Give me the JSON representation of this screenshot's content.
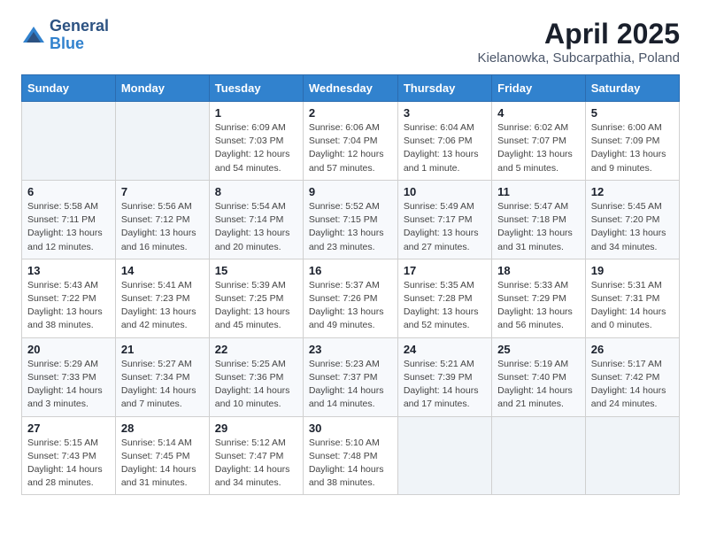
{
  "logo": {
    "general": "General",
    "blue": "Blue"
  },
  "header": {
    "title": "April 2025",
    "subtitle": "Kielanowka, Subcarpathia, Poland"
  },
  "weekdays": [
    "Sunday",
    "Monday",
    "Tuesday",
    "Wednesday",
    "Thursday",
    "Friday",
    "Saturday"
  ],
  "weeks": [
    [
      {
        "day": "",
        "info": ""
      },
      {
        "day": "",
        "info": ""
      },
      {
        "day": "1",
        "info": "Sunrise: 6:09 AM\nSunset: 7:03 PM\nDaylight: 12 hours and 54 minutes."
      },
      {
        "day": "2",
        "info": "Sunrise: 6:06 AM\nSunset: 7:04 PM\nDaylight: 12 hours and 57 minutes."
      },
      {
        "day": "3",
        "info": "Sunrise: 6:04 AM\nSunset: 7:06 PM\nDaylight: 13 hours and 1 minute."
      },
      {
        "day": "4",
        "info": "Sunrise: 6:02 AM\nSunset: 7:07 PM\nDaylight: 13 hours and 5 minutes."
      },
      {
        "day": "5",
        "info": "Sunrise: 6:00 AM\nSunset: 7:09 PM\nDaylight: 13 hours and 9 minutes."
      }
    ],
    [
      {
        "day": "6",
        "info": "Sunrise: 5:58 AM\nSunset: 7:11 PM\nDaylight: 13 hours and 12 minutes."
      },
      {
        "day": "7",
        "info": "Sunrise: 5:56 AM\nSunset: 7:12 PM\nDaylight: 13 hours and 16 minutes."
      },
      {
        "day": "8",
        "info": "Sunrise: 5:54 AM\nSunset: 7:14 PM\nDaylight: 13 hours and 20 minutes."
      },
      {
        "day": "9",
        "info": "Sunrise: 5:52 AM\nSunset: 7:15 PM\nDaylight: 13 hours and 23 minutes."
      },
      {
        "day": "10",
        "info": "Sunrise: 5:49 AM\nSunset: 7:17 PM\nDaylight: 13 hours and 27 minutes."
      },
      {
        "day": "11",
        "info": "Sunrise: 5:47 AM\nSunset: 7:18 PM\nDaylight: 13 hours and 31 minutes."
      },
      {
        "day": "12",
        "info": "Sunrise: 5:45 AM\nSunset: 7:20 PM\nDaylight: 13 hours and 34 minutes."
      }
    ],
    [
      {
        "day": "13",
        "info": "Sunrise: 5:43 AM\nSunset: 7:22 PM\nDaylight: 13 hours and 38 minutes."
      },
      {
        "day": "14",
        "info": "Sunrise: 5:41 AM\nSunset: 7:23 PM\nDaylight: 13 hours and 42 minutes."
      },
      {
        "day": "15",
        "info": "Sunrise: 5:39 AM\nSunset: 7:25 PM\nDaylight: 13 hours and 45 minutes."
      },
      {
        "day": "16",
        "info": "Sunrise: 5:37 AM\nSunset: 7:26 PM\nDaylight: 13 hours and 49 minutes."
      },
      {
        "day": "17",
        "info": "Sunrise: 5:35 AM\nSunset: 7:28 PM\nDaylight: 13 hours and 52 minutes."
      },
      {
        "day": "18",
        "info": "Sunrise: 5:33 AM\nSunset: 7:29 PM\nDaylight: 13 hours and 56 minutes."
      },
      {
        "day": "19",
        "info": "Sunrise: 5:31 AM\nSunset: 7:31 PM\nDaylight: 14 hours and 0 minutes."
      }
    ],
    [
      {
        "day": "20",
        "info": "Sunrise: 5:29 AM\nSunset: 7:33 PM\nDaylight: 14 hours and 3 minutes."
      },
      {
        "day": "21",
        "info": "Sunrise: 5:27 AM\nSunset: 7:34 PM\nDaylight: 14 hours and 7 minutes."
      },
      {
        "day": "22",
        "info": "Sunrise: 5:25 AM\nSunset: 7:36 PM\nDaylight: 14 hours and 10 minutes."
      },
      {
        "day": "23",
        "info": "Sunrise: 5:23 AM\nSunset: 7:37 PM\nDaylight: 14 hours and 14 minutes."
      },
      {
        "day": "24",
        "info": "Sunrise: 5:21 AM\nSunset: 7:39 PM\nDaylight: 14 hours and 17 minutes."
      },
      {
        "day": "25",
        "info": "Sunrise: 5:19 AM\nSunset: 7:40 PM\nDaylight: 14 hours and 21 minutes."
      },
      {
        "day": "26",
        "info": "Sunrise: 5:17 AM\nSunset: 7:42 PM\nDaylight: 14 hours and 24 minutes."
      }
    ],
    [
      {
        "day": "27",
        "info": "Sunrise: 5:15 AM\nSunset: 7:43 PM\nDaylight: 14 hours and 28 minutes."
      },
      {
        "day": "28",
        "info": "Sunrise: 5:14 AM\nSunset: 7:45 PM\nDaylight: 14 hours and 31 minutes."
      },
      {
        "day": "29",
        "info": "Sunrise: 5:12 AM\nSunset: 7:47 PM\nDaylight: 14 hours and 34 minutes."
      },
      {
        "day": "30",
        "info": "Sunrise: 5:10 AM\nSunset: 7:48 PM\nDaylight: 14 hours and 38 minutes."
      },
      {
        "day": "",
        "info": ""
      },
      {
        "day": "",
        "info": ""
      },
      {
        "day": "",
        "info": ""
      }
    ]
  ]
}
